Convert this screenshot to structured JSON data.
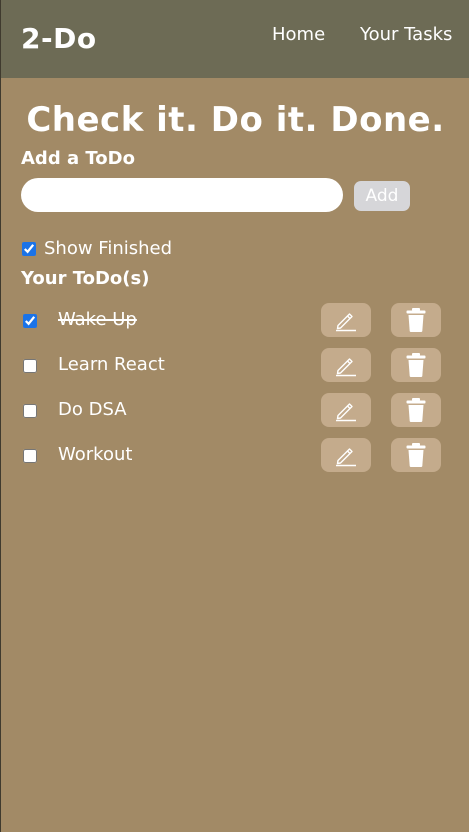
{
  "navbar": {
    "brand": "2-Do",
    "links": [
      {
        "label": "Home"
      },
      {
        "label": "Your Tasks"
      }
    ]
  },
  "main": {
    "headline": "Check it. Do it. Done.",
    "add_heading": "Add a ToDo",
    "input": {
      "value": "",
      "placeholder": ""
    },
    "add_button": "Add",
    "show_finished": {
      "label": "Show Finished",
      "checked": true
    },
    "list_heading": "Your ToDo(s)",
    "todos": [
      {
        "text": "Wake Up",
        "done": true
      },
      {
        "text": "Learn React",
        "done": false
      },
      {
        "text": "Do DSA",
        "done": false
      },
      {
        "text": "Workout",
        "done": false
      }
    ]
  },
  "icons": {
    "edit": "pencil-icon",
    "delete": "trash-icon"
  },
  "colors": {
    "page_background": "#a28a66",
    "navbar_background": "#6d6b55",
    "icon_button_background": "#c4ab8c",
    "add_button_background": "#d6d6d9",
    "checkbox_accent": "#1a73e8"
  }
}
